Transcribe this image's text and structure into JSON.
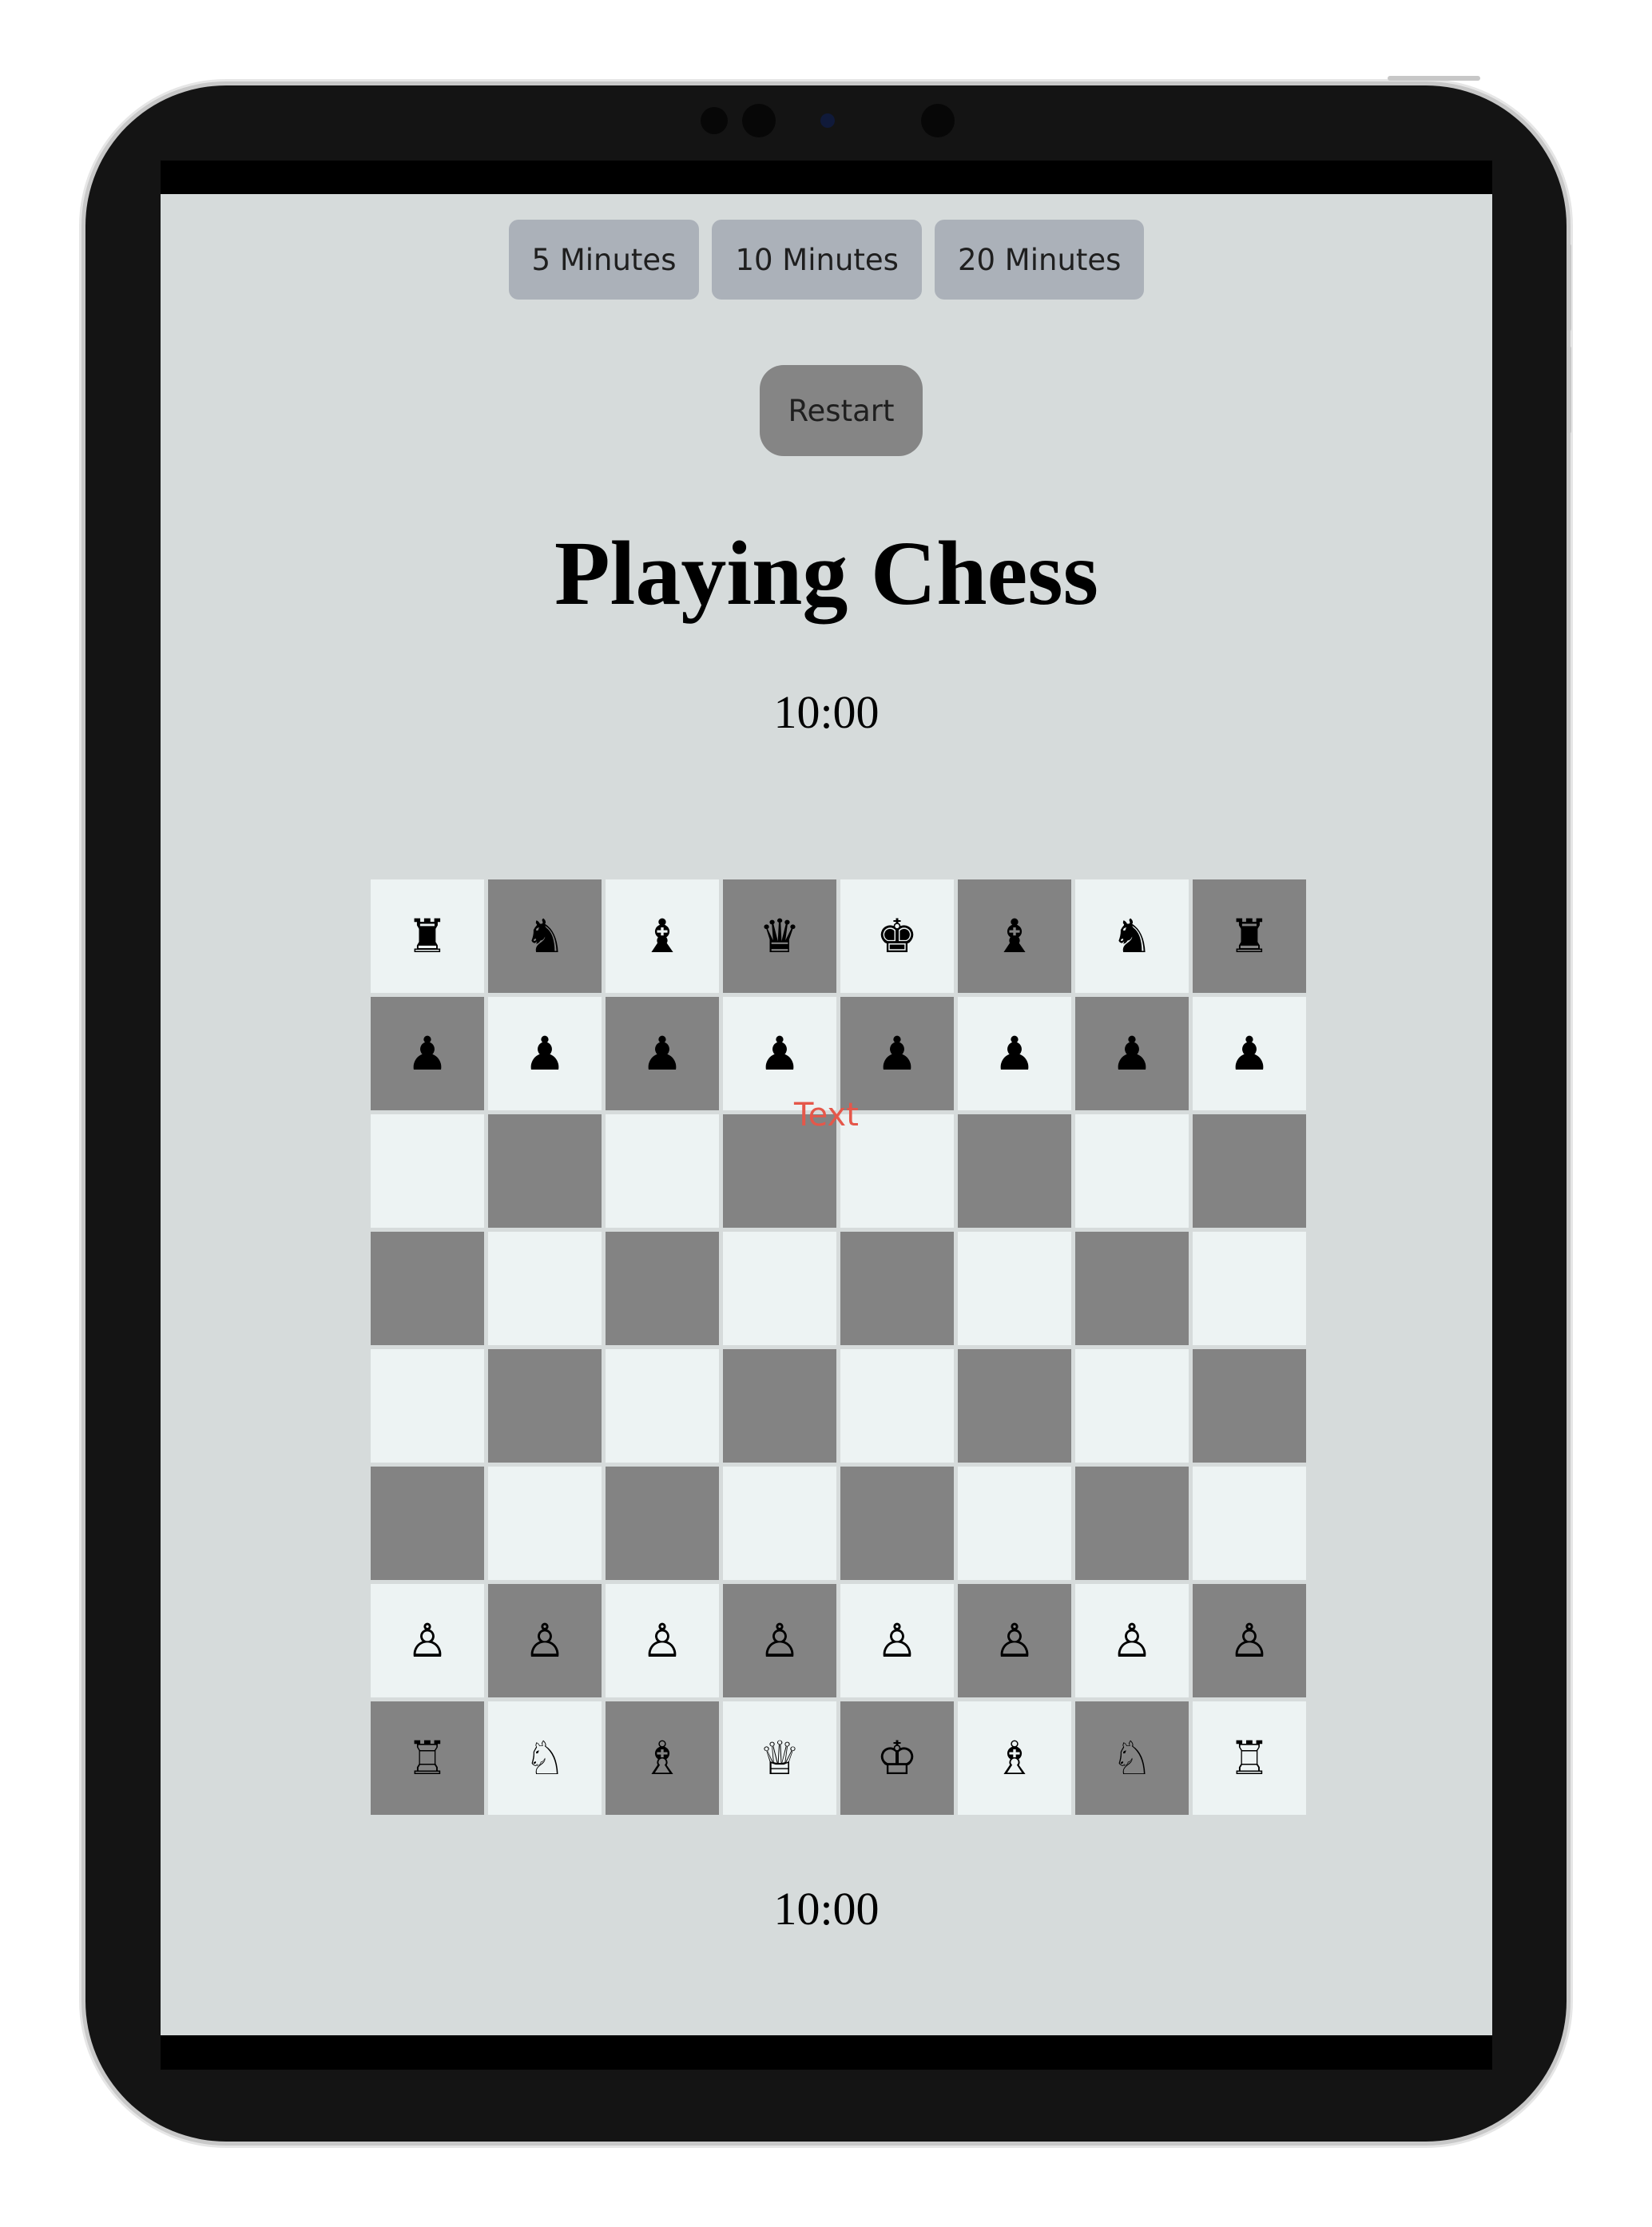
{
  "time_options": [
    "5 Minutes",
    "10 Minutes",
    "20 Minutes"
  ],
  "restart_label": "Restart",
  "title": "Playing Chess",
  "timers": {
    "top": "10:00",
    "bottom": "10:00"
  },
  "overlay_label": "Text",
  "colors": {
    "background": "#d6dbdb",
    "light_square": "#edf3f3",
    "dark_square": "#838383",
    "time_button": "#abb1b9",
    "restart_button": "#858585",
    "overlay_text": "#e5574a"
  },
  "board": [
    [
      "♜",
      "♞",
      "♝",
      "♛",
      "♚",
      "♝",
      "♞",
      "♜"
    ],
    [
      "♟",
      "♟",
      "♟",
      "♟",
      "♟",
      "♟",
      "♟",
      "♟"
    ],
    [
      "",
      "",
      "",
      "",
      "",
      "",
      "",
      ""
    ],
    [
      "",
      "",
      "",
      "",
      "",
      "",
      "",
      ""
    ],
    [
      "",
      "",
      "",
      "",
      "",
      "",
      "",
      ""
    ],
    [
      "",
      "",
      "",
      "",
      "",
      "",
      "",
      ""
    ],
    [
      "♙",
      "♙",
      "♙",
      "♙",
      "♙",
      "♙",
      "♙",
      "♙"
    ],
    [
      "♖",
      "♘",
      "♗",
      "♕",
      "♔",
      "♗",
      "♘",
      "♖"
    ]
  ]
}
